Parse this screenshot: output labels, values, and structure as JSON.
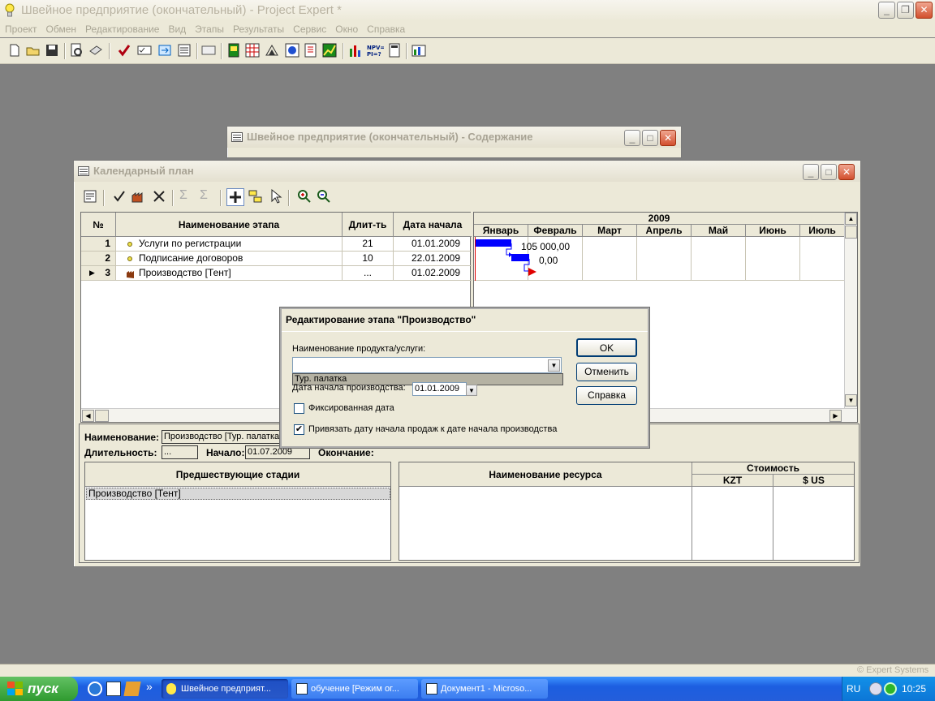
{
  "app": {
    "title": "Швейное предприятие (окончательный) - Project Expert *",
    "menu": [
      "Проект",
      "Обмен",
      "Редактирование",
      "Вид",
      "Этапы",
      "Результаты",
      "Сервис",
      "Окно",
      "Справка"
    ],
    "toolbar_icons": [
      "new-icon",
      "open-icon",
      "save-icon",
      "preview-icon",
      "print-icon",
      "check-icon",
      "checklist-icon",
      "exchange-icon",
      "text-icon",
      "report-icon",
      "book-icon",
      "chart-icon",
      "analysis-icon",
      "globe-icon",
      "edit-icon",
      "graph-icon",
      "bars-icon",
      "npv-icon",
      "calc-icon",
      "stats-icon"
    ]
  },
  "contents_window": {
    "title": "Швейное предприятие (окончательный) - Содержание"
  },
  "calendar": {
    "title": "Календарный план",
    "grid": {
      "headers": {
        "num": "№",
        "name": "Наименование этапа",
        "duration": "Длит-ть",
        "start": "Дата начала"
      },
      "rows": [
        {
          "num": "1",
          "name": "Услуги по регистрации",
          "duration": "21",
          "start": "01.01.2009",
          "type": "bullet"
        },
        {
          "num": "2",
          "name": "Подписание договоров",
          "duration": "10",
          "start": "22.01.2009",
          "type": "bullet"
        },
        {
          "num": "3",
          "name": "Производство [Тент]",
          "duration": "...",
          "start": "01.02.2009",
          "type": "factory"
        }
      ]
    },
    "gantt": {
      "year": "2009",
      "months": [
        "Январь",
        "Февраль",
        "Март",
        "Апрель",
        "Май",
        "Июнь",
        "Июль"
      ],
      "labels": [
        "105 000,00",
        "0,00"
      ]
    },
    "details": {
      "name_label": "Наименование:",
      "name_value": "Производство [Тур. палатка",
      "duration_label": "Длительность:",
      "duration_value": "...",
      "start_label": "Начало:",
      "start_value": "01.07.2009",
      "end_label": "Окончание:",
      "end_value": "...",
      "pred_header": "Предшествующие стадии",
      "pred_items": [
        "Производство [Тент]"
      ],
      "res_header": "Наименование ресурса",
      "cost_header": "Стоимость",
      "cost_cols": [
        "KZT",
        "$ US"
      ]
    }
  },
  "dialog": {
    "title": "Редактирование этапа \"Производство\"",
    "product_label": "Наименование продукта/услуги:",
    "product_value": "",
    "dropdown_option": "Тур. палатка",
    "start_label": "Дата начала производства:",
    "start_value": "01.01.2009",
    "fixed_date_label": "Фиксированная дата",
    "fixed_date_checked": false,
    "link_label": "Привязать дату начала продаж к дате начала производства",
    "link_checked": true,
    "ok": "OK",
    "cancel": "Отменить",
    "help": "Справка"
  },
  "statusbar": {
    "brand": "© Expert Systems"
  },
  "taskbar": {
    "start": "пуск",
    "tasks": [
      "Швейное предприят...",
      "обучение [Режим ог...",
      "Документ1 - Microso..."
    ],
    "lang": "RU",
    "time": "10:25"
  }
}
